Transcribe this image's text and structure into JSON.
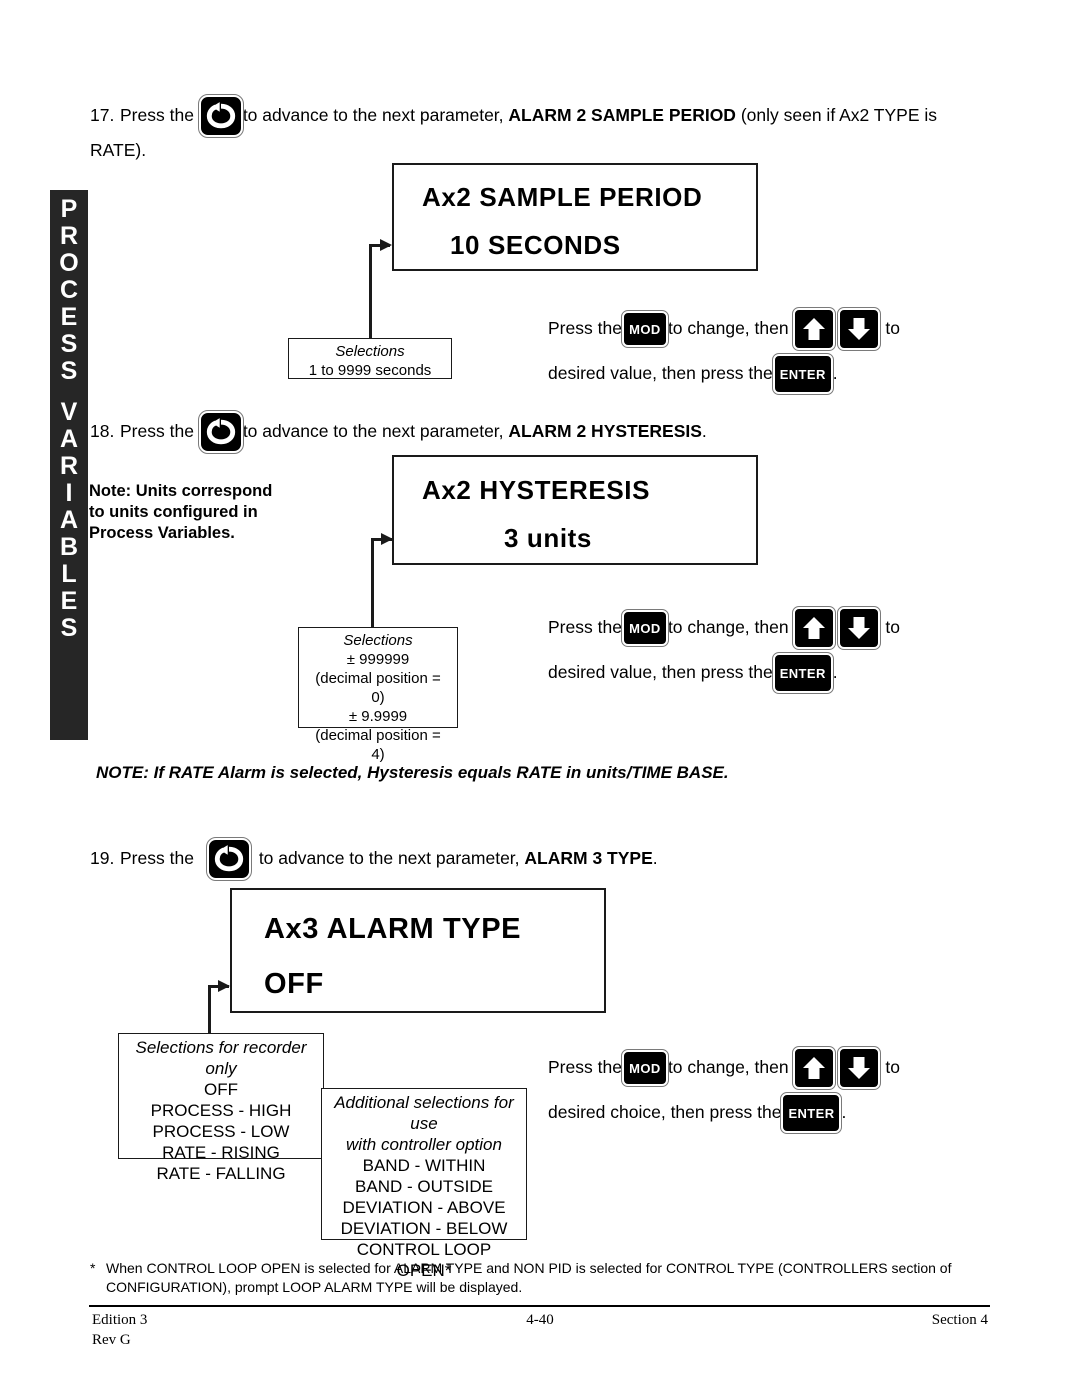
{
  "sidebar": {
    "tab_label": "PROCESS VARIABLES",
    "line1": "PROCESS",
    "line2": "VARIABLES",
    "background": "#262626"
  },
  "steps": [
    {
      "number": "17.",
      "text_before_key": "Press the",
      "key": "advance-key",
      "text_after_key_1": "to advance to the next parameter,",
      "bold_parameter": "ALARM 2 SAMPLE PERIOD",
      "text_after_key_2": "(only seen if Ax2 TYPE  is",
      "wrap_line": "RATE)."
    },
    {
      "number": "18.",
      "text_before_key": "Press the",
      "key": "advance-key",
      "text_after_key_1": "to advance to the next parameter,",
      "bold_parameter": "ALARM 2 HYSTERESIS",
      "text_after_key_2": "."
    },
    {
      "number": "19.",
      "text_before_key": "Press the",
      "key": "advance-key",
      "text_after_key_1": "to advance to the next parameter,",
      "bold_parameter": "ALARM 3 TYPE",
      "text_after_key_2": "."
    }
  ],
  "displays": [
    {
      "prompt": "Ax2 SAMPLE PERIOD",
      "value": "10  SECONDS"
    },
    {
      "prompt": "Ax2 HYSTERESIS",
      "value": "3  units"
    },
    {
      "prompt": "Ax3 ALARM TYPE",
      "value": "OFF"
    }
  ],
  "selections": {
    "sample_period": {
      "title": "Selections",
      "lines": [
        "1 to 9999 seconds"
      ]
    },
    "hysteresis": {
      "title": "Selections",
      "lines": [
        "± 999999",
        "(decimal position = 0)",
        "± 9.9999",
        "(decimal position = 4)"
      ]
    },
    "alarm_type_recorder": {
      "title": "Selections for recorder only",
      "lines": [
        "OFF",
        "PROCESS - HIGH",
        "PROCESS - LOW",
        "RATE - RISING",
        "RATE - FALLING"
      ]
    },
    "alarm_type_controller": {
      "title_line1": "Additional selections for use",
      "title_line2": "with controller option",
      "lines": [
        "BAND - WITHIN",
        "BAND - OUTSIDE",
        "DEVIATION - ABOVE",
        "DEVIATION - BELOW",
        "CONTROL LOOP OPEN*"
      ]
    }
  },
  "instructions": [
    {
      "press_the": "Press the",
      "mod_label": "MOD",
      "to_change_then": "to change, then",
      "up_icon": "arrow-up-icon",
      "down_icon": "arrow-down-icon",
      "to": "to",
      "second_line": "desired value, then press the",
      "enter_label": "ENTER",
      "period": "."
    },
    {
      "press_the": "Press the",
      "mod_label": "MOD",
      "to_change_then": "to change, then",
      "up_icon": "arrow-up-icon",
      "down_icon": "arrow-down-icon",
      "to": "to",
      "second_line": "desired value, then press the",
      "enter_label": "ENTER",
      "period": "."
    },
    {
      "press_the": "Press the",
      "mod_label": "MOD",
      "to_change_then": "to change, then",
      "up_icon": "arrow-up-icon",
      "down_icon": "arrow-down-icon",
      "to": "to",
      "second_line": "desired choice, then press the",
      "enter_label": "ENTER",
      "period": "."
    }
  ],
  "units_note": {
    "line1": "Note: Units correspond",
    "line2": "to units configured in",
    "line3": "Process Variables."
  },
  "rate_note": "NOTE:  If RATE Alarm is selected, Hysteresis equals RATE in units/TIME BASE.",
  "footnote": {
    "marker": "*",
    "line1": "When CONTROL LOOP OPEN is selected for ALARM TYPE and NON PID is selected for CONTROL TYPE (CONTROLLERS section of",
    "line2": "CONFIGURATION), prompt LOOP ALARM TYPE will be displayed."
  },
  "footer": {
    "edition": "Edition 3",
    "rev": "Rev G",
    "page": "4-40",
    "section": "Section 4"
  }
}
